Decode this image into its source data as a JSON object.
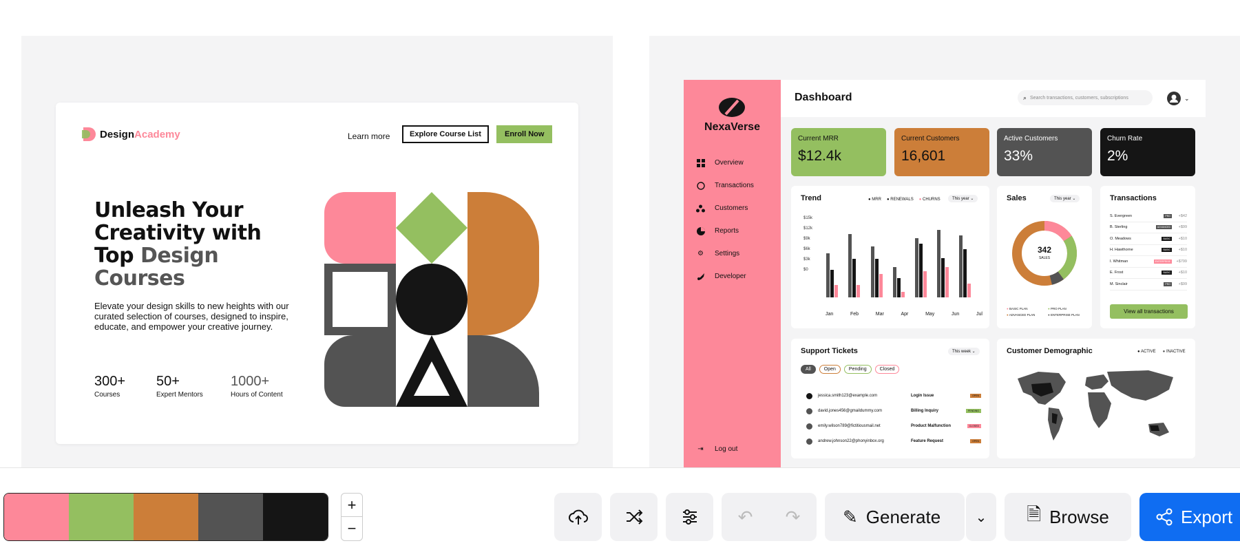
{
  "palette": [
    "#fd8899",
    "#94bf60",
    "#cc7e39",
    "#535353",
    "#151515"
  ],
  "landing": {
    "brand_a": "Design",
    "brand_b": "Academy",
    "learn_more": "Learn more",
    "explore": "Explore Course List",
    "enroll": "Enroll Now",
    "hero_1": "Unleash Your",
    "hero_2": "Creativity with",
    "hero_3a": "Top ",
    "hero_3b": "Design",
    "hero_4": "Courses",
    "subtitle": "Elevate your design skills to new heights with our curated selection of courses, designed to inspire, educate, and empower your creative journey.",
    "stats": [
      {
        "value": "300+",
        "label": "Courses"
      },
      {
        "value": "50+",
        "label": "Expert Mentors"
      },
      {
        "value": "1000+",
        "label": "Hours of Content"
      }
    ]
  },
  "dashboard": {
    "brand": "NexaVerse",
    "title": "Dashboard",
    "search_placeholder": "Search transactions, customers, subscriptions",
    "nav": [
      "Overview",
      "Transactions",
      "Customers",
      "Reports",
      "Settings",
      "Developer"
    ],
    "logout": "Log out",
    "kpis": [
      {
        "title": "Current MRR",
        "value": "$12.4k"
      },
      {
        "title": "Current Customers",
        "value": "16,601"
      },
      {
        "title": "Active Customers",
        "value": "33%"
      },
      {
        "title": "Churn Rate",
        "value": "2%"
      }
    ],
    "trend": {
      "title": "Trend",
      "period": "This year",
      "legend": [
        "MRR",
        "RENEWALS",
        "CHURNS"
      ],
      "y_ticks": [
        "$15k",
        "$12k",
        "$9k",
        "$6k",
        "$3k",
        "$0"
      ],
      "x_ticks": [
        "Jan",
        "Feb",
        "Mar",
        "Apr",
        "May",
        "Jun",
        "Jul"
      ]
    },
    "sales": {
      "title": "Sales",
      "period": "This year",
      "total": "342",
      "total_label": "SALES",
      "legend": [
        "BASIC PLAN",
        "PRO PLAN",
        "ADVANCED PLAN",
        "ENTERPRISE PLAN"
      ]
    },
    "transactions": {
      "title": "Transactions",
      "rows": [
        {
          "name": "S. Evergreen",
          "plan": "PRO",
          "amount": "+$42"
        },
        {
          "name": "B. Sterling",
          "plan": "ADVANCED",
          "amount": "+$99"
        },
        {
          "name": "O. Meadows",
          "plan": "BASIC",
          "amount": "+$10"
        },
        {
          "name": "H. Hawthorne",
          "plan": "BASIC",
          "amount": "+$10"
        },
        {
          "name": "I. Whitman",
          "plan": "ENTERPRISE",
          "amount": "+$799"
        },
        {
          "name": "E. Frost",
          "plan": "BASIC",
          "amount": "+$10"
        },
        {
          "name": "M. Sinclair",
          "plan": "PRO",
          "amount": "+$99"
        }
      ],
      "button": "View all transactions"
    },
    "tickets": {
      "title": "Support Tickets",
      "period": "This week",
      "filters": [
        "All",
        "Open",
        "Pending",
        "Closed"
      ],
      "rows": [
        {
          "email": "jessica.smith123@example.com",
          "issue": "Login Issue",
          "status": "OPEN"
        },
        {
          "email": "david.jones456@gmaildummy.com",
          "issue": "Billing Inquiry",
          "status": "PENDING"
        },
        {
          "email": "emily.wilson789@fictitiousmail.net",
          "issue": "Product Malfunction",
          "status": "CLOSED"
        },
        {
          "email": "andrew.johnson22@phonyinbox.org",
          "issue": "Feature Request",
          "status": "OPEN"
        }
      ]
    },
    "demographic": {
      "title": "Customer Demographic",
      "legend": [
        "ACTIVE",
        "INACTIVE"
      ]
    }
  },
  "toolbar": {
    "generate": "Generate",
    "browse": "Browse",
    "export": "Export"
  }
}
